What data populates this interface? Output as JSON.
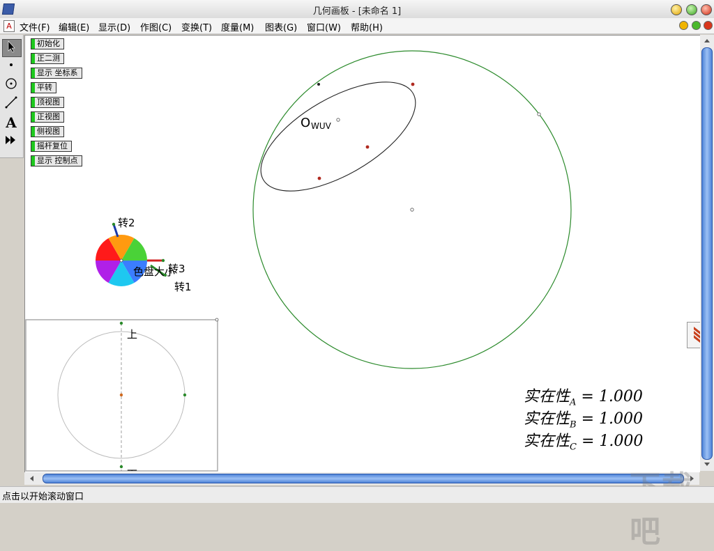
{
  "window": {
    "title": "几何画板 - [未命名 1]",
    "controls": [
      "minimize",
      "maximize",
      "close"
    ]
  },
  "menubar": {
    "items": [
      "文件(F)",
      "编辑(E)",
      "显示(D)",
      "作图(C)",
      "变换(T)",
      "度量(M)",
      "图表(G)",
      "窗口(W)",
      "帮助(H)"
    ]
  },
  "toolbox": {
    "tools": [
      "arrow-select-tool",
      "point-tool",
      "compass-tool",
      "straightedge-tool",
      "text-tool",
      "custom-tool"
    ]
  },
  "buttons": [
    "初始化",
    "正二测",
    "显示 坐标系",
    "平转",
    "顶视图",
    "正视图",
    "侧视图",
    "摇杆复位",
    "显示 控制点"
  ],
  "canvas": {
    "ellipse_label": "O",
    "ellipse_label_sub": "WUV",
    "dial": {
      "label_rot2": "转2",
      "label_rot3": "转3",
      "label_rot1": "转1",
      "label_disk": "色盘大小"
    },
    "inset": {
      "label_top": "上",
      "label_bottom": "下"
    },
    "measurements": [
      {
        "name": "实在性",
        "sub": "A",
        "eq": "= 1.000"
      },
      {
        "name": "实在性",
        "sub": "B",
        "eq": "= 1.000"
      },
      {
        "name": "实在性",
        "sub": "C",
        "eq": "= 1.000"
      }
    ]
  },
  "status": {
    "message": "点击以开始滚动窗口"
  },
  "colors": {
    "circle": "#2b8a2b",
    "ellipse": "#222222",
    "led": "#1ec81e",
    "scroll": "#4f84d8"
  },
  "watermark": "下载吧"
}
